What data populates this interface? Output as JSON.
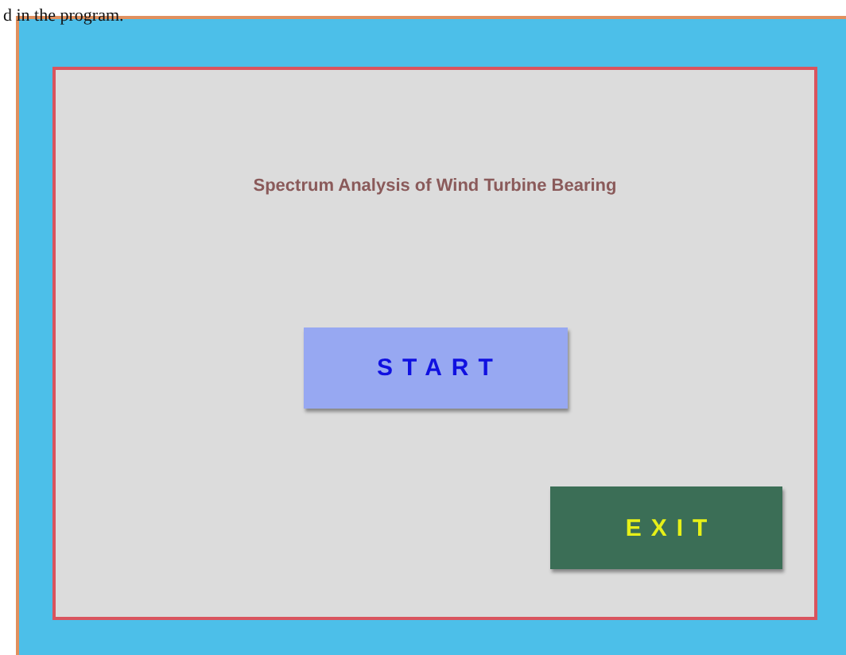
{
  "caption": "d in the program.",
  "window": {
    "title": "Spectrum Analysis of Wind Turbine Bearing"
  },
  "buttons": [
    {
      "label": "START",
      "kind": "start"
    },
    {
      "label": "EXIT",
      "kind": "exit"
    }
  ]
}
